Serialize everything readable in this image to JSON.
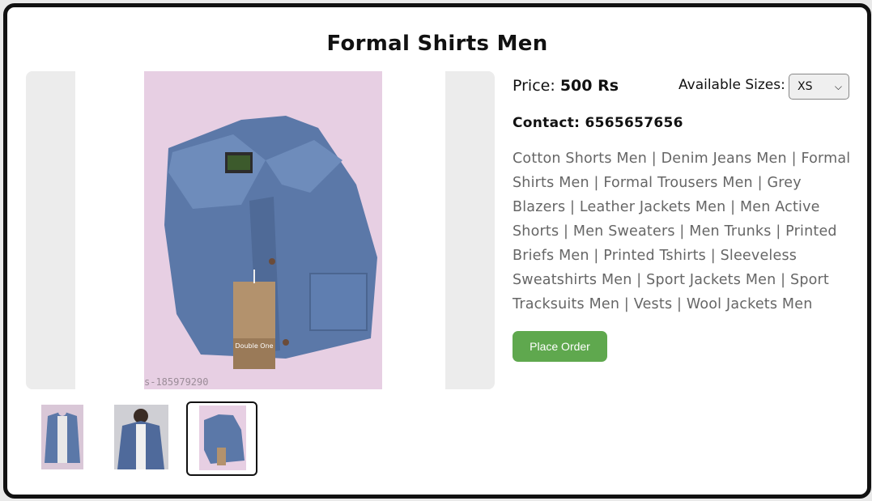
{
  "product": {
    "title": "Formal Shirts Men",
    "price_label": "Price:",
    "price_value": "500 Rs",
    "sizes_label": "Available Sizes:",
    "selected_size": "XS",
    "contact_label": "Contact:",
    "contact_value": "6565657656",
    "categories": "Cotton Shorts Men | Denim Jeans Men | Formal Shirts Men | Formal Trousers Men | Grey Blazers | Leather Jackets Men | Men Active Shorts | Men Sweaters | Men Trunks | Printed Briefs Men | Printed Tshirts | Sleeveless Sweatshirts Men | Sport Jackets Men | Sport Tracksuits Men | Vests | Wool Jackets Men",
    "order_button": "Place Order",
    "image_watermark": "s-185979290"
  },
  "colors": {
    "accent_button": "#5fa84e",
    "denim": "#5b78a8",
    "photo_background": "#e7cfe3"
  },
  "thumbnails": [
    {
      "label": "thumbnail 1",
      "active": false
    },
    {
      "label": "thumbnail 2",
      "active": false
    },
    {
      "label": "thumbnail 3",
      "active": true
    }
  ]
}
